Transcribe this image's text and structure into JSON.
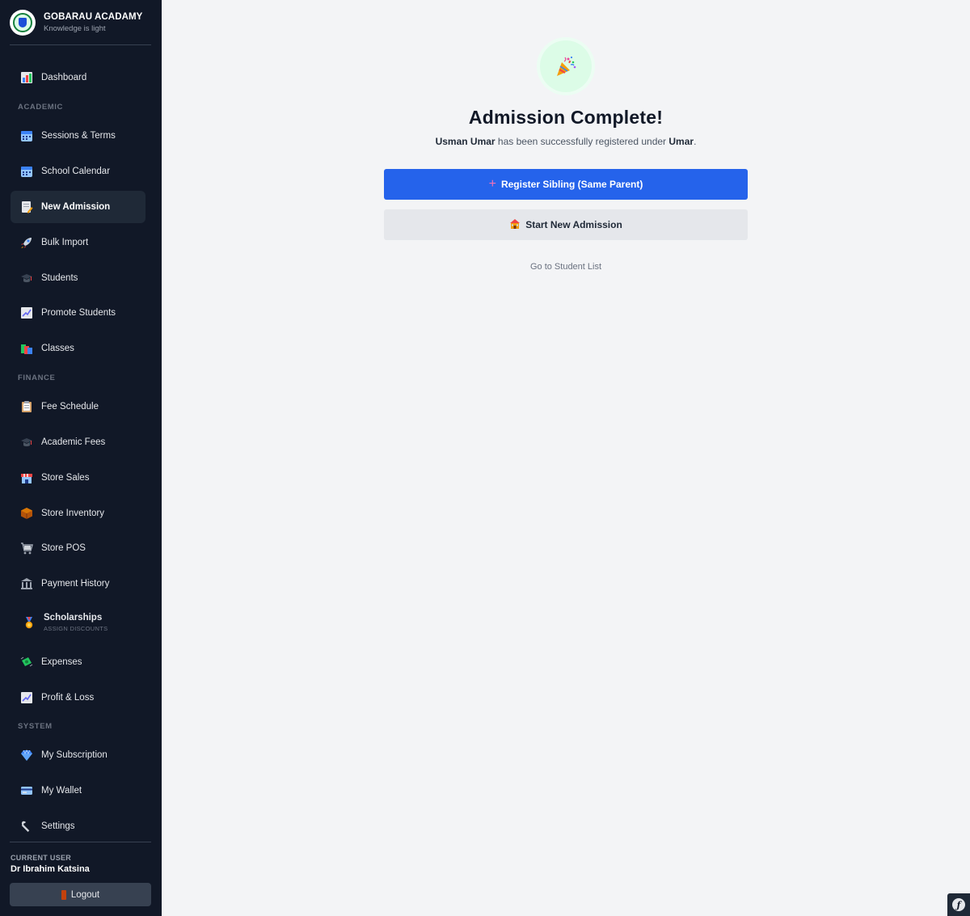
{
  "brand": {
    "name": "GOBARAU ACADAMY",
    "tagline": "Knowledge is light"
  },
  "sidebar": {
    "dashboard": "Dashboard",
    "sections": {
      "academic": "ACADEMIC",
      "finance": "FINANCE",
      "system": "SYSTEM"
    },
    "items": {
      "sessions": "Sessions & Terms",
      "calendar": "School Calendar",
      "new_admission": "New Admission",
      "bulk_import": "Bulk Import",
      "students": "Students",
      "promote": "Promote Students",
      "classes": "Classes",
      "fee_schedule": "Fee Schedule",
      "academic_fees": "Academic Fees",
      "store_sales": "Store Sales",
      "store_inventory": "Store Inventory",
      "store_pos": "Store POS",
      "payment_history": "Payment History",
      "scholarships": "Scholarships",
      "scholarships_sub": "ASSIGN DISCOUNTS",
      "expenses": "Expenses",
      "profit_loss": "Profit & Loss",
      "subscription": "My Subscription",
      "wallet": "My Wallet",
      "settings": "Settings"
    },
    "current_user_label": "CURRENT USER",
    "current_user_name": "Dr Ibrahim Katsina",
    "logout": "Logout"
  },
  "main": {
    "title": "Admission Complete!",
    "student_name": "Usman Umar",
    "message_middle": " has been successfully registered under ",
    "parent_name": "Umar",
    "message_end": ".",
    "register_sibling": "Register Sibling (Same Parent)",
    "start_new": "Start New Admission",
    "student_list_link": "Go to Student List"
  },
  "colors": {
    "sidebar_bg": "#111827",
    "primary": "#2563eb",
    "success_bg": "#dcfce7"
  }
}
